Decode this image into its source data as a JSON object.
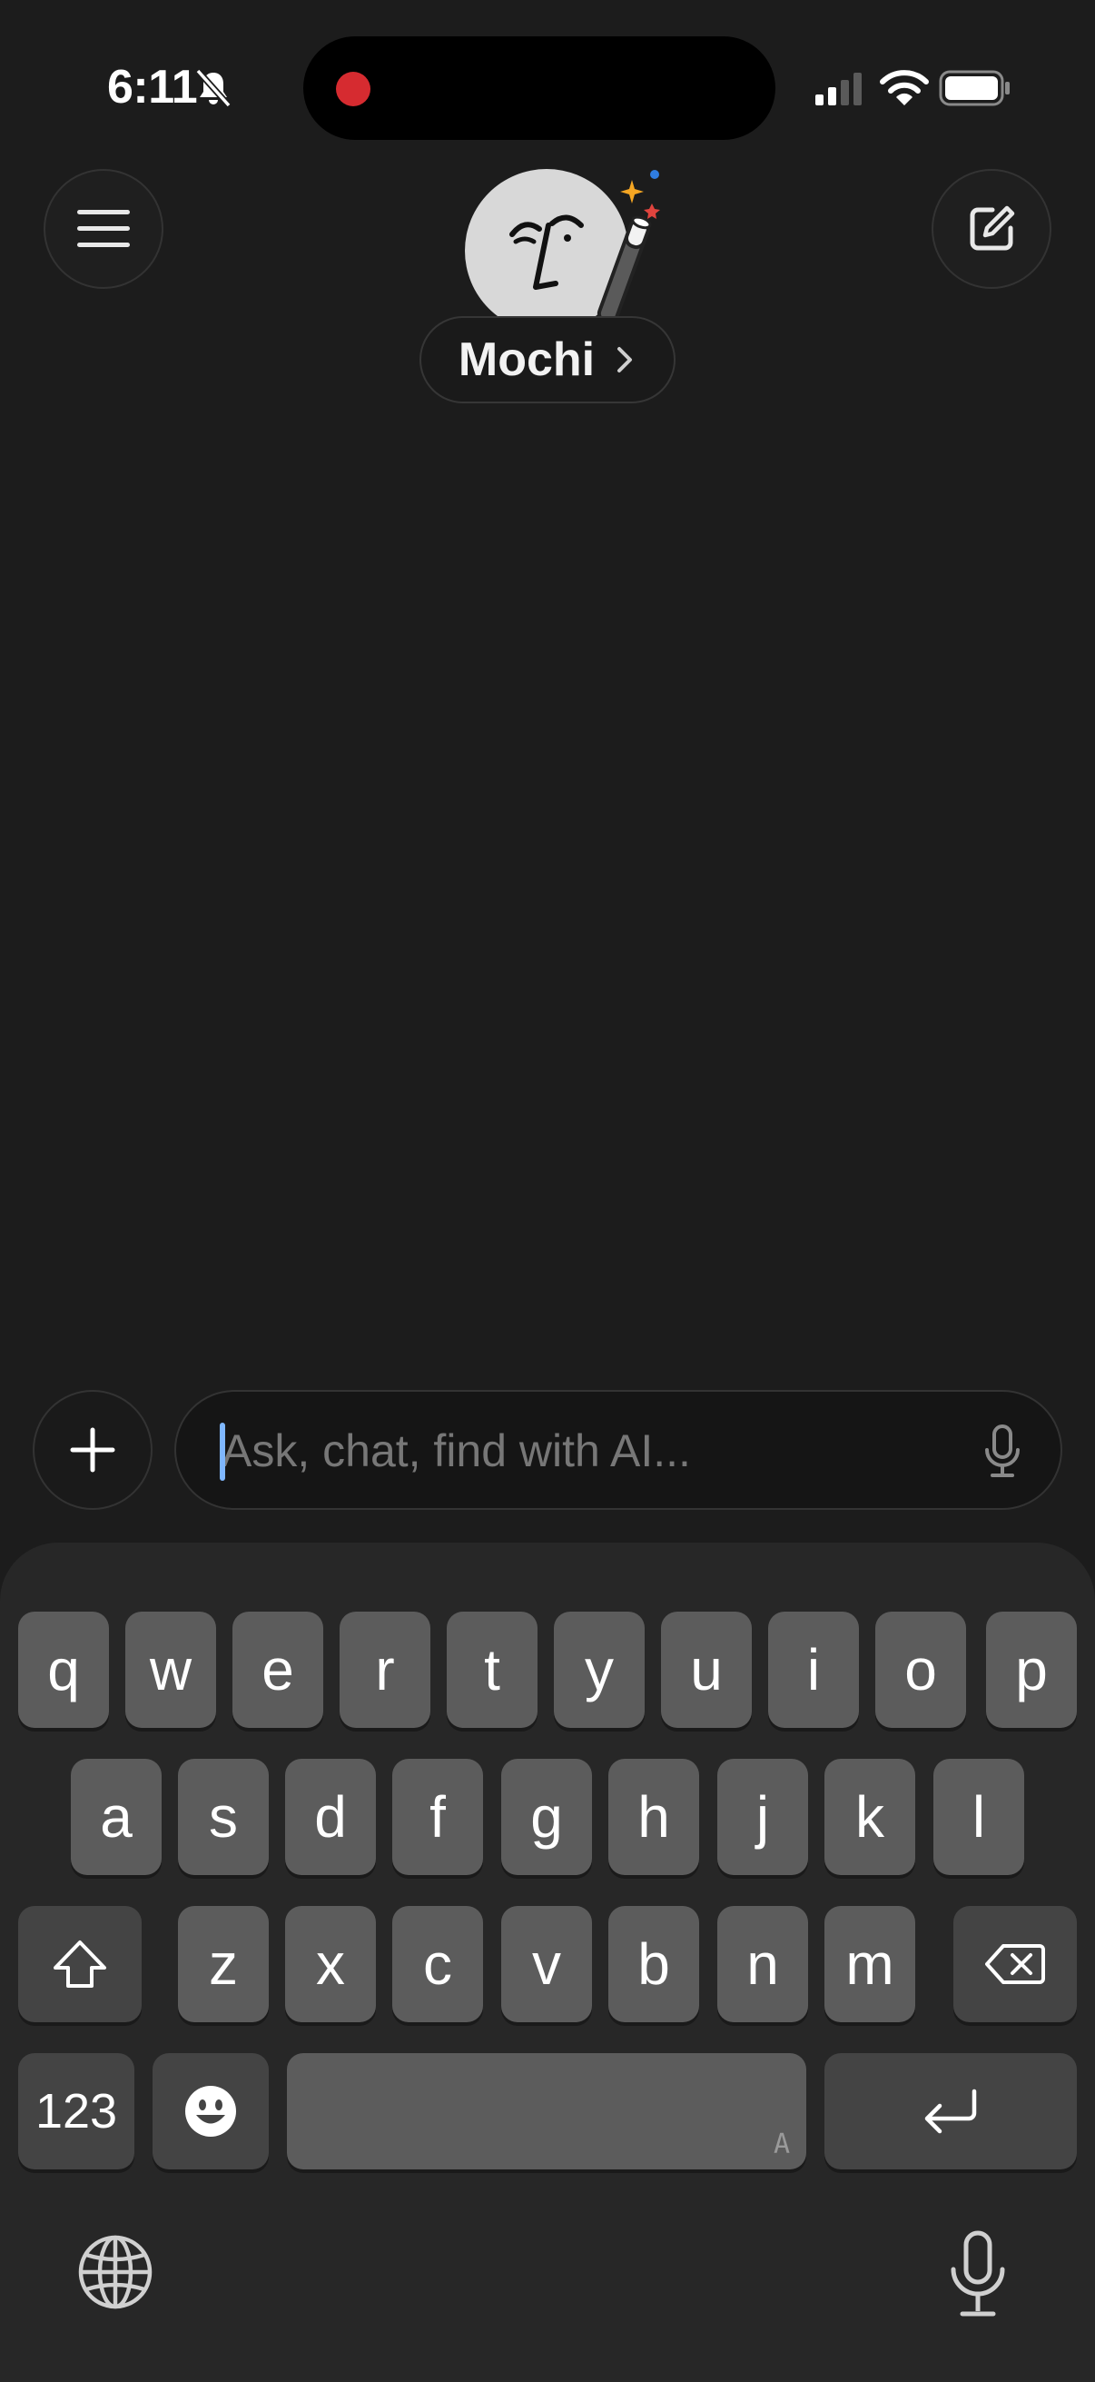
{
  "status_bar": {
    "time": "6:11",
    "icons": [
      "bell-slash-icon",
      "cellular-signal-icon",
      "wifi-icon",
      "battery-icon"
    ],
    "recording_indicator_color": "#d62b30"
  },
  "header": {
    "menu_icon": "hamburger-menu-icon",
    "compose_icon": "compose-icon",
    "model_name": "Mochi",
    "model_chevron_icon": "chevron-right-icon",
    "avatar_icon": "face-avatar-with-magic-wand"
  },
  "composer": {
    "add_icon": "plus-icon",
    "placeholder": "Ask, chat, find with AI...",
    "value": "",
    "mic_icon": "microphone-icon",
    "caret_color": "#7fb7ff"
  },
  "keyboard": {
    "row1": [
      "q",
      "w",
      "e",
      "r",
      "t",
      "y",
      "u",
      "i",
      "o",
      "p"
    ],
    "row2": [
      "a",
      "s",
      "d",
      "f",
      "g",
      "h",
      "j",
      "k",
      "l"
    ],
    "row3": [
      "z",
      "x",
      "c",
      "v",
      "b",
      "n",
      "m"
    ],
    "numbers_key": "123",
    "space_hint": "A",
    "shift_icon": "shift-icon",
    "delete_icon": "delete-backward-icon",
    "emoji_icon": "emoji-icon",
    "return_icon": "return-icon",
    "globe_icon": "globe-icon",
    "dictation_icon": "microphone-icon"
  },
  "colors": {
    "background": "#1c1c1c",
    "keyboard_bg": "#272727",
    "key_bg": "#5c5c5c"
  }
}
